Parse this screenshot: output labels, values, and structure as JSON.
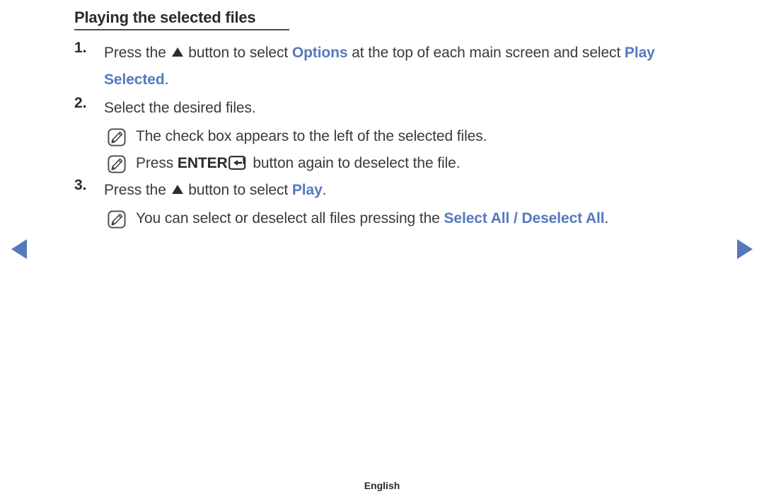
{
  "page": {
    "heading": "Playing the selected files",
    "footer_language": "English",
    "accent_color": "#5579bd",
    "text_color": "#3a3a3a",
    "background_color": "#ffffff"
  },
  "nav": {
    "prev_label": "previous page",
    "next_label": "next page",
    "prev_icon": "triangle-left-icon",
    "next_icon": "triangle-right-icon"
  },
  "steps": [
    {
      "number": "1.",
      "segments": [
        {
          "text": "Press the ",
          "style": "plain"
        },
        {
          "text": "",
          "style": "up-arrow-icon"
        },
        {
          "text": " button to select ",
          "style": "plain"
        },
        {
          "text": "Options",
          "style": "accent-bold"
        },
        {
          "text": " at the top of each main screen and select ",
          "style": "plain"
        },
        {
          "text": "Play Selected",
          "style": "accent-bold"
        },
        {
          "text": ".",
          "style": "plain"
        }
      ],
      "notes": []
    },
    {
      "number": "2.",
      "segments": [
        {
          "text": "Select the desired files.",
          "style": "plain"
        }
      ],
      "notes": [
        {
          "icon": "note-pencil-icon",
          "segments": [
            {
              "text": "The check box appears to the left of the selected files.",
              "style": "plain"
            }
          ]
        },
        {
          "icon": "note-pencil-icon",
          "segments": [
            {
              "text": "Press ",
              "style": "plain"
            },
            {
              "text": "ENTER",
              "style": "bold"
            },
            {
              "text": "",
              "style": "enter-key-icon"
            },
            {
              "text": " button again to deselect the file.",
              "style": "plain"
            }
          ]
        }
      ]
    },
    {
      "number": "3.",
      "segments": [
        {
          "text": "Press the ",
          "style": "plain"
        },
        {
          "text": "",
          "style": "up-arrow-icon"
        },
        {
          "text": " button to select ",
          "style": "plain"
        },
        {
          "text": "Play",
          "style": "accent-bold"
        },
        {
          "text": ".",
          "style": "plain"
        }
      ],
      "notes": [
        {
          "icon": "note-pencil-icon",
          "segments": [
            {
              "text": "You can select or deselect all files pressing the ",
              "style": "plain"
            },
            {
              "text": "Select All / Deselect All",
              "style": "accent-bold"
            },
            {
              "text": ".",
              "style": "plain"
            }
          ]
        }
      ]
    }
  ]
}
